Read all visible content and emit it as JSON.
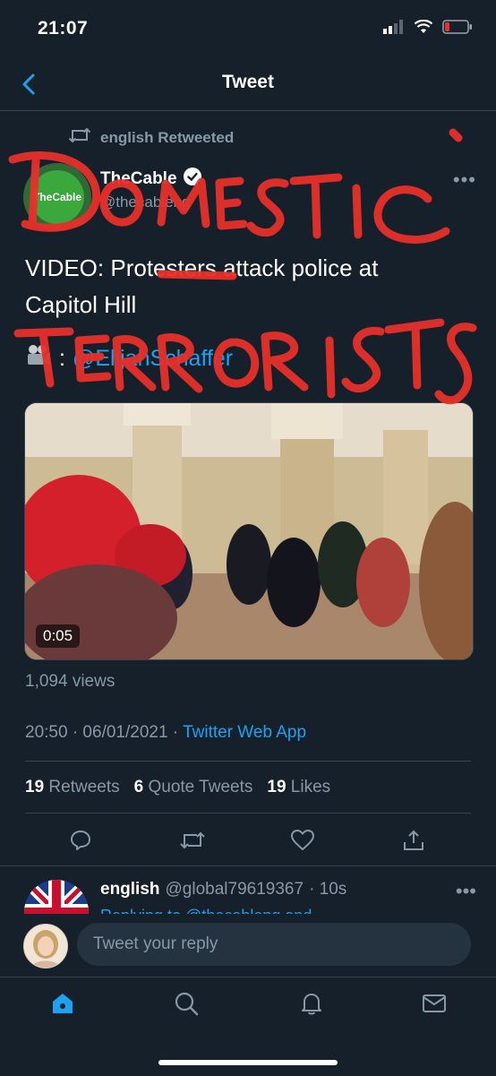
{
  "status_bar": {
    "time": "21:07"
  },
  "header": {
    "title": "Tweet"
  },
  "retweet": {
    "text": "english Retweeted"
  },
  "author": {
    "name": "TheCable",
    "handle": "@thecableng",
    "avatar_text": "TheCable"
  },
  "tweet": {
    "line1": "VIDEO: Protesters attack police at",
    "line2": "Capitol Hill",
    "credit_prefix": ":",
    "credit_handle": "@ElijahSchaffer"
  },
  "media": {
    "duration": "0:05"
  },
  "views": "1,094 views",
  "timestamp": {
    "time": "20:50 · 06/01/2021 · ",
    "source": "Twitter Web App"
  },
  "stats": {
    "retweets_count": "19",
    "retweets_label": "Retweets",
    "quotes_count": "6",
    "quotes_label": "Quote Tweets",
    "likes_count": "19",
    "likes_label": "Likes"
  },
  "reply": {
    "name": "english",
    "handle": "@global79619367",
    "time": "· 10s",
    "preview": "Replying to @thecableng and"
  },
  "composer": {
    "placeholder": "Tweet your reply"
  },
  "annotation": {
    "word1": "DOMESTIC",
    "word2": "TERRORISTS"
  },
  "colors": {
    "background": "#15202b",
    "accent": "#1da1f2",
    "muted": "#8899a6",
    "marker": "#e8302a"
  },
  "icons": [
    "back-arrow-icon",
    "retweet-icon",
    "verified-icon",
    "more-icon",
    "reply-icon",
    "like-icon",
    "share-icon",
    "home-icon",
    "search-icon",
    "bell-icon",
    "mail-icon",
    "camera-icon"
  ]
}
